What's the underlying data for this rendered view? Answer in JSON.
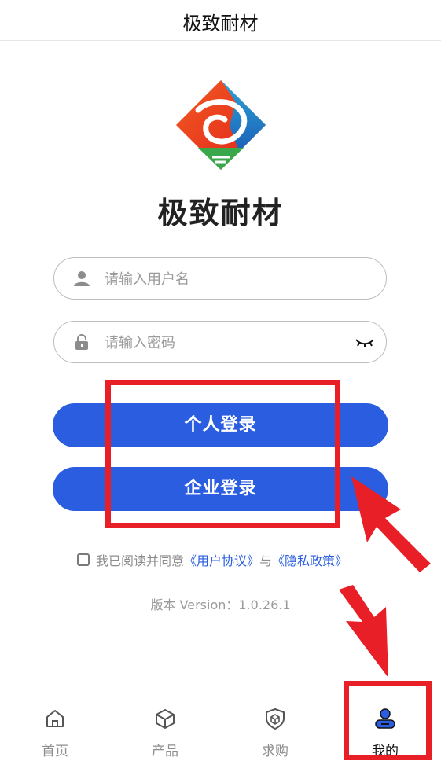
{
  "header": {
    "title": "极致耐材"
  },
  "brand": {
    "name": "极致耐材",
    "logo_icon": "diamond-dragon-logo"
  },
  "login": {
    "username_placeholder": "请输入用户名",
    "password_placeholder": "请输入密码",
    "personal_login_label": "个人登录",
    "enterprise_login_label": "企业登录"
  },
  "agreement": {
    "prefix": "我已阅读并同意",
    "user_agreement": "《用户协议》",
    "and": "与",
    "privacy_policy": "《隐私政策》",
    "checked": false
  },
  "version": {
    "text": "版本 Version：1.0.26.1"
  },
  "tabbar": {
    "items": [
      {
        "label": "首页",
        "icon": "home-icon"
      },
      {
        "label": "产品",
        "icon": "box-icon"
      },
      {
        "label": "求购",
        "icon": "shield-box-icon"
      },
      {
        "label": "我的",
        "icon": "user-icon",
        "active": true
      }
    ]
  },
  "colors": {
    "primary": "#2a5de0",
    "annotation": "#e91f27"
  }
}
